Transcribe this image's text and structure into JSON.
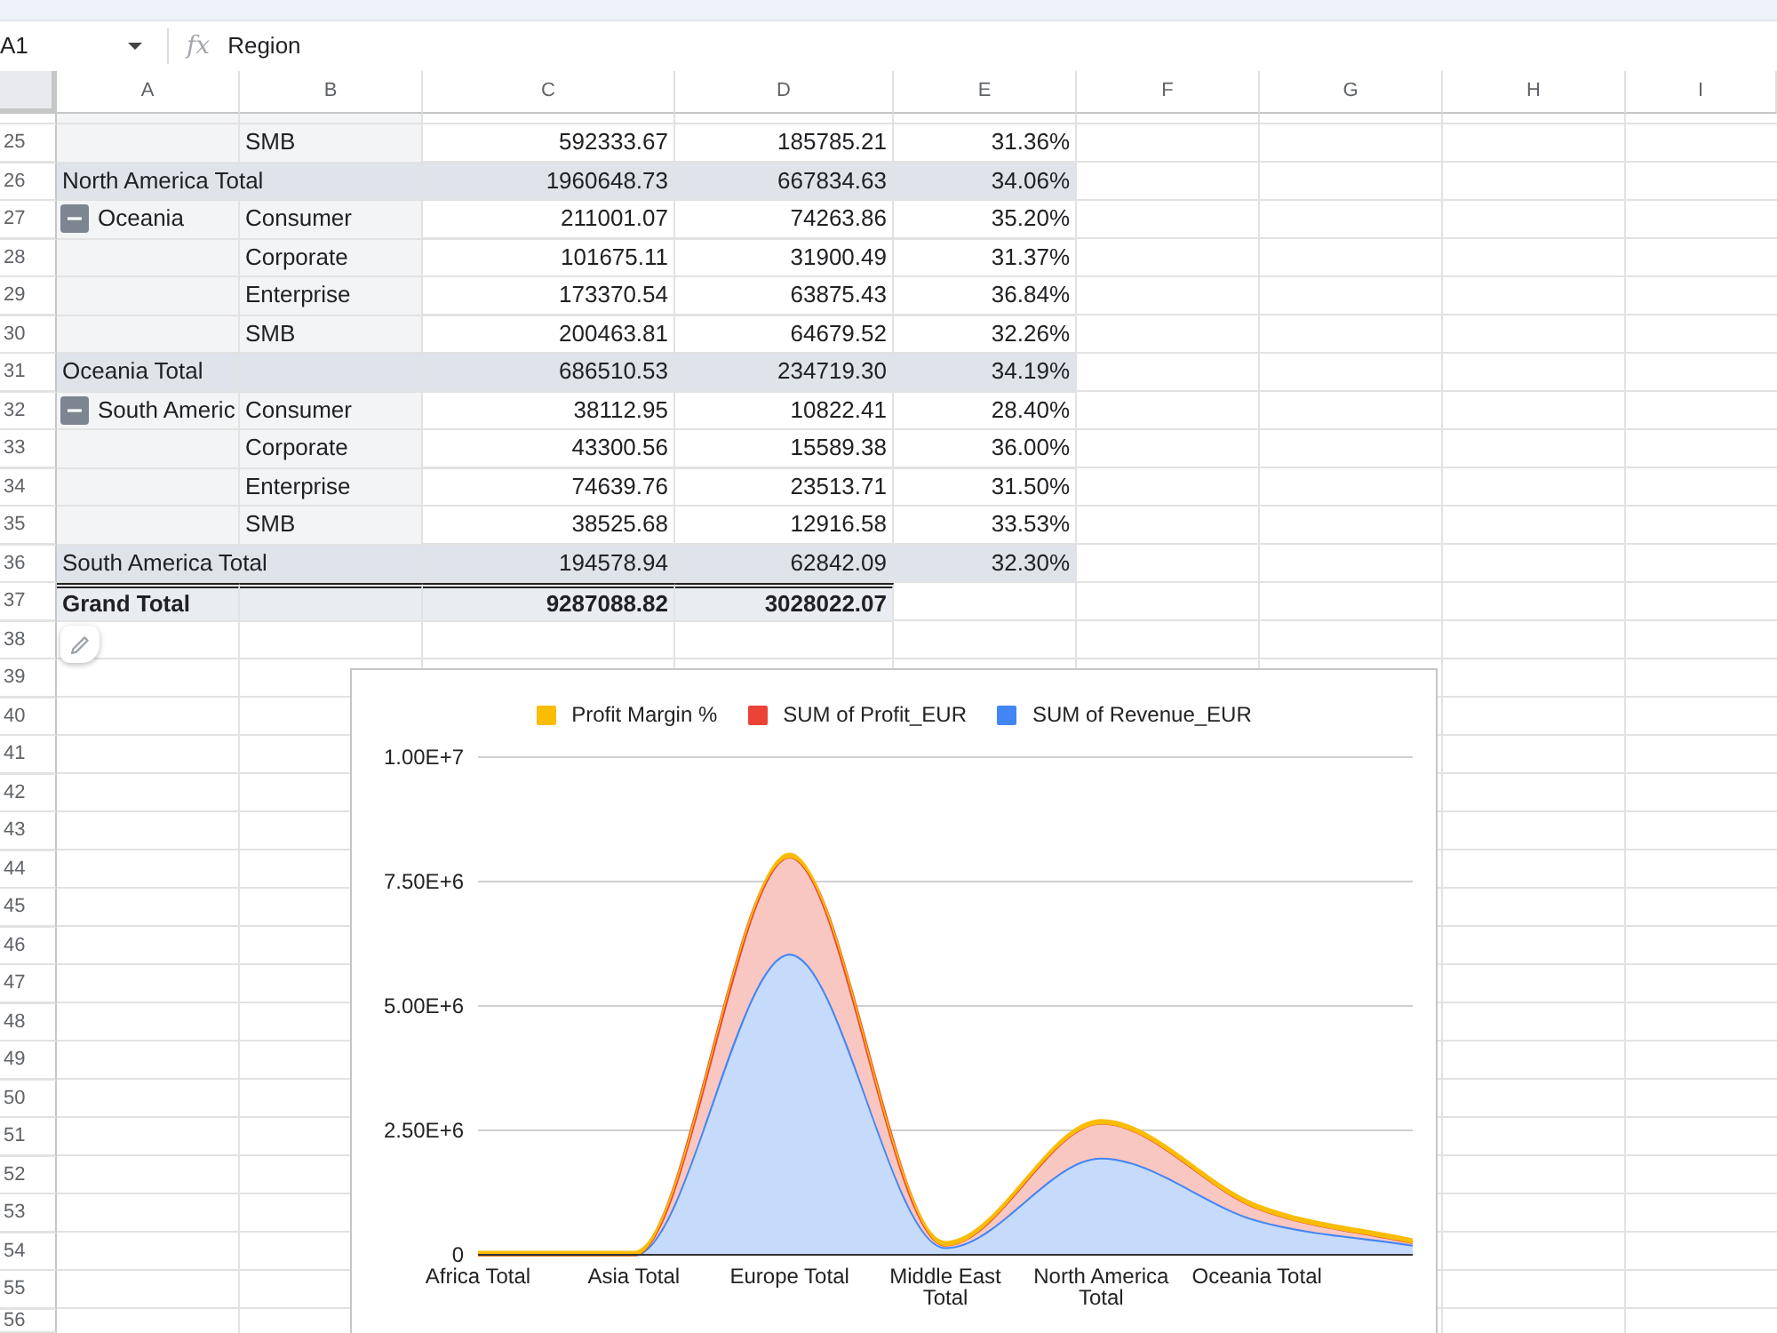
{
  "formula_bar": {
    "cell_reference": "A1",
    "function_label": "fx",
    "formula": "Region"
  },
  "column_headers": [
    "A",
    "B",
    "C",
    "D",
    "E",
    "F",
    "G",
    "H",
    "I"
  ],
  "rows": [
    {
      "number": "25",
      "kind": "detail",
      "cells": [
        null,
        "SMB",
        "592333.67",
        "185785.21",
        "31.36%"
      ]
    },
    {
      "number": "26",
      "kind": "subtotal",
      "cells": [
        "North America Total",
        null,
        "1960648.73",
        "667834.63",
        "34.06%"
      ]
    },
    {
      "number": "27",
      "kind": "group",
      "expanded": true,
      "cells": [
        "Oceania",
        "Consumer",
        "211001.07",
        "74263.86",
        "35.20%"
      ]
    },
    {
      "number": "28",
      "kind": "detail",
      "cells": [
        null,
        "Corporate",
        "101675.11",
        "31900.49",
        "31.37%"
      ]
    },
    {
      "number": "29",
      "kind": "detail",
      "cells": [
        null,
        "Enterprise",
        "173370.54",
        "63875.43",
        "36.84%"
      ]
    },
    {
      "number": "30",
      "kind": "detail",
      "cells": [
        null,
        "SMB",
        "200463.81",
        "64679.52",
        "32.26%"
      ]
    },
    {
      "number": "31",
      "kind": "subtotal",
      "cells": [
        "Oceania Total",
        null,
        "686510.53",
        "234719.30",
        "34.19%"
      ]
    },
    {
      "number": "32",
      "kind": "group",
      "expanded": true,
      "cells": [
        "South Americ",
        "Consumer",
        "38112.95",
        "10822.41",
        "28.40%"
      ]
    },
    {
      "number": "33",
      "kind": "detail",
      "cells": [
        null,
        "Corporate",
        "43300.56",
        "15589.38",
        "36.00%"
      ]
    },
    {
      "number": "34",
      "kind": "detail",
      "cells": [
        null,
        "Enterprise",
        "74639.76",
        "23513.71",
        "31.50%"
      ]
    },
    {
      "number": "35",
      "kind": "detail",
      "cells": [
        null,
        "SMB",
        "38525.68",
        "12916.58",
        "33.53%"
      ]
    },
    {
      "number": "36",
      "kind": "subtotal",
      "cells": [
        "South America Total",
        null,
        "194578.94",
        "62842.09",
        "32.30%"
      ]
    },
    {
      "number": "37",
      "kind": "grand_total",
      "cells": [
        "Grand Total",
        null,
        "9287088.82",
        "3028022.07",
        null
      ]
    },
    {
      "number": "38",
      "kind": "empty"
    },
    {
      "number": "39",
      "kind": "empty"
    },
    {
      "number": "40",
      "kind": "empty"
    },
    {
      "number": "41",
      "kind": "empty"
    },
    {
      "number": "42",
      "kind": "empty"
    },
    {
      "number": "43",
      "kind": "empty"
    },
    {
      "number": "44",
      "kind": "empty"
    },
    {
      "number": "45",
      "kind": "empty"
    },
    {
      "number": "46",
      "kind": "empty"
    },
    {
      "number": "47",
      "kind": "empty"
    },
    {
      "number": "48",
      "kind": "empty"
    },
    {
      "number": "49",
      "kind": "empty"
    },
    {
      "number": "50",
      "kind": "empty"
    },
    {
      "number": "51",
      "kind": "empty"
    },
    {
      "number": "52",
      "kind": "empty"
    },
    {
      "number": "53",
      "kind": "empty"
    },
    {
      "number": "54",
      "kind": "empty"
    },
    {
      "number": "55",
      "kind": "empty"
    },
    {
      "number": "56",
      "kind": "empty"
    }
  ],
  "chart": {
    "chart_data": {
      "type": "area",
      "stacked": true,
      "grid": true,
      "legend": "top",
      "categories": [
        "Africa Total",
        "Asia Total",
        "Europe Total",
        "Middle East Total",
        "North America Total",
        "Oceania Total",
        null
      ],
      "series": [
        {
          "name": "SUM of Revenue_EUR",
          "color": "#4285f4",
          "values": [
            0,
            0,
            6050000,
            150000,
            1950000,
            700000,
            200000
          ]
        },
        {
          "name": "SUM of Profit_EUR",
          "color": "#ea4335",
          "values": [
            0,
            0,
            1950000,
            50000,
            700000,
            250000,
            50000
          ]
        },
        {
          "name": "Profit Margin %",
          "color": "#fbbc04",
          "values": [
            0,
            0,
            0,
            0,
            0,
            0,
            0
          ]
        }
      ],
      "ylim": [
        0,
        10000000
      ],
      "yticks": [
        {
          "value": 0,
          "label": "0"
        },
        {
          "value": 2500000,
          "label": "2.50E+6"
        },
        {
          "value": 5000000,
          "label": "5.00E+6"
        },
        {
          "value": 7500000,
          "label": "7.50E+6"
        },
        {
          "value": 10000000,
          "label": "1.00E+7"
        }
      ]
    }
  }
}
